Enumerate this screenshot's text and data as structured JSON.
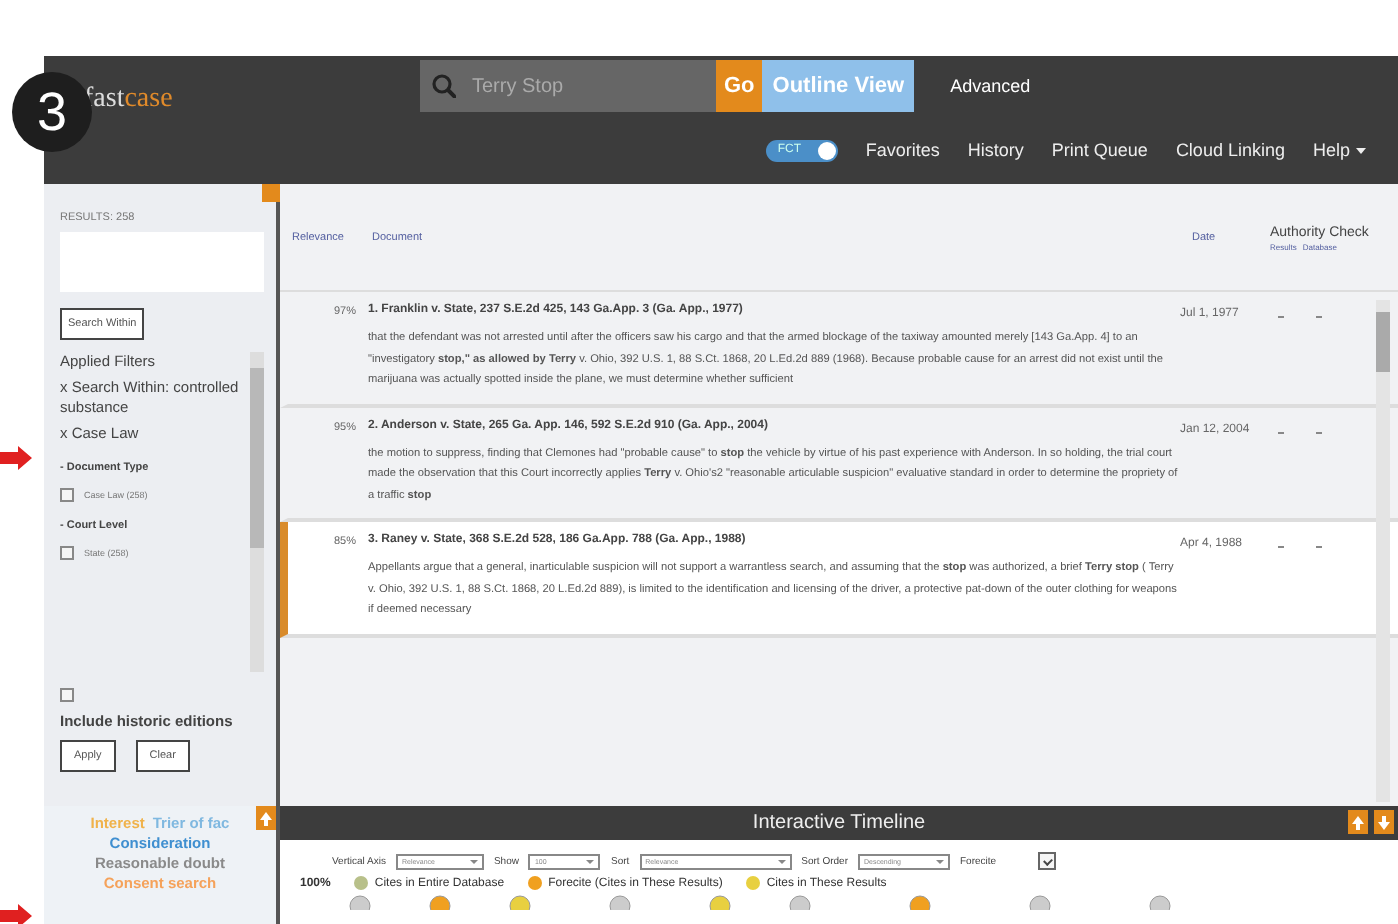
{
  "step_badge": "3",
  "header": {
    "logo": {
      "first": "fast",
      "second": "case"
    },
    "search": {
      "value": "Terry Stop"
    },
    "go_button": "Go",
    "outline_button": "Outline View",
    "advanced_link": "Advanced",
    "toggle": {
      "label": "FCT",
      "on": true
    },
    "nav": [
      "Favorites",
      "History",
      "Print Queue",
      "Cloud Linking"
    ],
    "help": "Help"
  },
  "sidebar": {
    "results_count": "RESULTS: 258",
    "search_within_button": "Search Within",
    "applied_filters_title": "Applied Filters",
    "applied_filters": [
      "x Search Within: controlled substance",
      "x Case Law"
    ],
    "facets": [
      {
        "title": "- Document Type",
        "options": [
          {
            "label": "Case Law (258)",
            "checked": false
          }
        ]
      },
      {
        "title": "- Court Level",
        "options": [
          {
            "label": "State (258)",
            "checked": false
          }
        ]
      }
    ],
    "historic": {
      "label": "Include historic editions",
      "checked": false
    },
    "buttons": [
      "Apply",
      "Clear"
    ]
  },
  "results": {
    "columns": {
      "relevance": "Relevance",
      "document": "Document",
      "date": "Date",
      "authority": "Authority Check",
      "results": "Results",
      "database": "Database"
    },
    "rows": [
      {
        "relevance": "97%",
        "title": "1. Franklin v. State, 237 S.E.2d 425, 143 Ga.App. 3 (Ga. App., 1977)",
        "date": "Jul 1, 1977",
        "selected": false,
        "snippet": "that the defendant was not arrested until after the officers saw his cargo and that the armed blockage of the taxiway amounted merely [143 Ga.App. 4] to an \"investigatory **stop,\" as allowed by Terry** v. Ohio, 392 U.S. 1, 88 S.Ct. 1868, 20 L.Ed.2d 889 (1968). Because probable cause for an arrest did not exist until the marijuana was actually spotted inside the plane, we must determine whether sufficient"
      },
      {
        "relevance": "95%",
        "title": "2. Anderson v. State, 265 Ga. App. 146, 592 S.E.2d 910 (Ga. App., 2004)",
        "date": "Jan 12, 2004",
        "selected": false,
        "snippet": "the motion to suppress, finding that Clemones had \"probable cause\" to **stop** the vehicle by virtue of his past experience with Anderson. In so holding, the trial court made the observation that this Court incorrectly applies **Terry** v. Ohio's2 \"reasonable articulable suspicion\" evaluative standard in order to determine the propriety of a traffic **stop**"
      },
      {
        "relevance": "85%",
        "title": "3. Raney v. State, 368 S.E.2d 528, 186 Ga.App. 788 (Ga. App., 1988)",
        "date": "Apr 4, 1988",
        "selected": true,
        "snippet": "Appellants argue that a general, inarticulable suspicion will not support a warrantless search, and assuming that the **stop** was authorized, a brief **Terry stop** ( Terry v. Ohio, 392 U.S. 1, 88 S.Ct. 1868, 20 L.Ed.2d 889), is limited to the identification and licensing of the driver, a protective pat-down of the outer clothing for weapons if deemed necessary"
      }
    ]
  },
  "word_cloud": [
    {
      "text": "Interest",
      "color": "#f0b24a"
    },
    {
      "text": "Trier of fac",
      "color": "#7fb8e0"
    },
    {
      "text": "Consideration",
      "color": "#3f8fd0"
    },
    {
      "text": "Reasonable doubt",
      "color": "#8a8a8a"
    },
    {
      "text": "Consent search",
      "color": "#f5a25a"
    }
  ],
  "timeline": {
    "title": "Interactive Timeline",
    "controls": [
      {
        "kind": "select",
        "label": "Vertical Axis",
        "value": "Relevance"
      },
      {
        "kind": "select",
        "label": "Show",
        "value": "100"
      },
      {
        "kind": "select",
        "label": "Sort",
        "value": "Relevance"
      },
      {
        "kind": "select",
        "label": "Sort Order",
        "value": "Descending"
      },
      {
        "kind": "checkbox",
        "label": "Forecite",
        "checked": true
      }
    ],
    "legend": [
      {
        "label": "Cites in Entire Database",
        "color": "#b8c08a"
      },
      {
        "label": "Forecite (Cites in These Results)",
        "color": "#f0a020"
      },
      {
        "label": "Cites in These Results",
        "color": "#e8d040"
      }
    ],
    "axis_label": "100%"
  }
}
